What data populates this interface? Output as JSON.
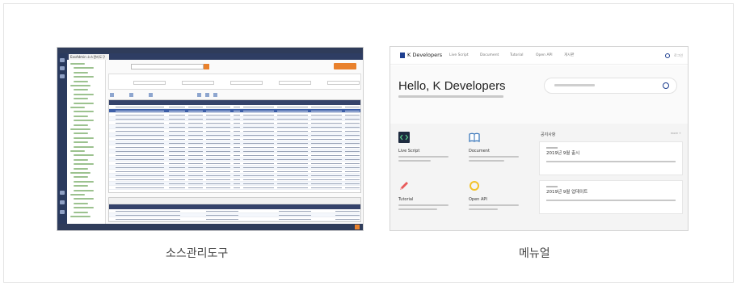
{
  "left_panel": {
    "tab_label": "ExsAdmin 소스관리도구",
    "caption": "소스관리도구"
  },
  "right_panel": {
    "brand": "K Developers",
    "menu": [
      "Live Script",
      "Document",
      "Tutorial",
      "Open API",
      "게시판"
    ],
    "login": "로그인",
    "hero_title": "Hello, K Developers",
    "cards": [
      {
        "title": "Live Script",
        "icon": "code-icon"
      },
      {
        "title": "Document",
        "icon": "book-icon"
      },
      {
        "title": "Tutorial",
        "icon": "pencil-icon"
      },
      {
        "title": "Open API",
        "icon": "ring-icon"
      }
    ],
    "notice_title": "공지사항",
    "more": "more +",
    "news": [
      "2019년 9월 출시",
      "2019년 9월 업데이트"
    ],
    "caption": "메뉴얼"
  },
  "colors": {
    "brand_navy": "#1d3e8f",
    "accent_orange": "#e9812c",
    "tool_dark": "#2f3c5a"
  }
}
